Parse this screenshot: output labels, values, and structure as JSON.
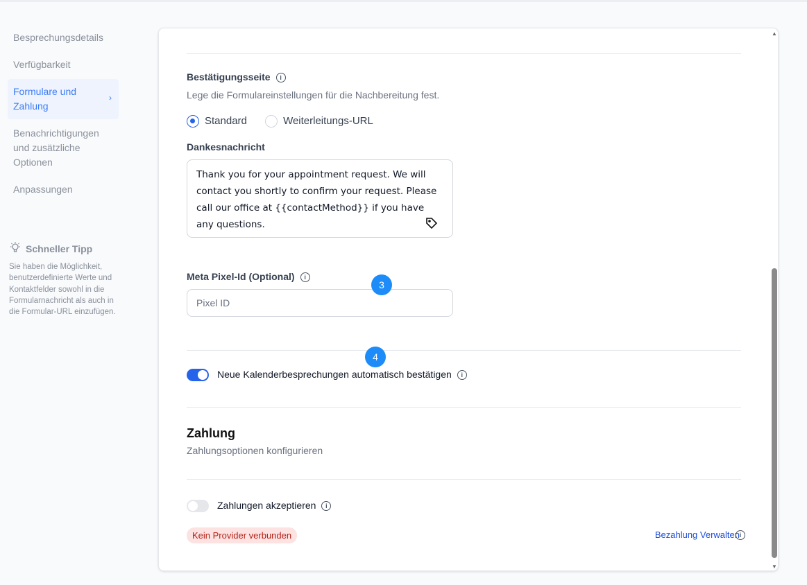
{
  "sidebar": {
    "items": [
      {
        "label": "Besprechungsdetails"
      },
      {
        "label": "Verfügbarkeit"
      },
      {
        "label": "Formulare und Zahlung",
        "active": true
      },
      {
        "label": "Benachrichtigungen und zusätzliche Optionen"
      },
      {
        "label": "Anpassungen"
      }
    ],
    "tip": {
      "title": "Schneller Tipp",
      "text": "Sie haben die Möglichkeit, benutzerdefinierte Werte und Kontaktfelder sowohl in die Formularnachricht als auch in die Formular-URL einzufügen."
    }
  },
  "confirmation": {
    "title": "Bestätigungsseite",
    "description": "Lege die Formulareinstellungen für die Nachbereitung fest.",
    "options": [
      {
        "label": "Standard",
        "selected": true
      },
      {
        "label": "Weiterleitungs-URL",
        "selected": false
      }
    ],
    "thanks_label": "Dankesnachricht",
    "thanks_value": "Thank you for your appointment request. We will contact you shortly to confirm your request. Please call our office at {{contactMethod}} if you have any questions."
  },
  "pixel": {
    "label": "Meta Pixel-Id (Optional)",
    "placeholder": "Pixel ID"
  },
  "badges": [
    "3",
    "4"
  ],
  "auto_confirm": {
    "label": "Neue Kalenderbesprechungen automatisch bestätigen",
    "enabled": true
  },
  "payment": {
    "title": "Zahlung",
    "subtitle": "Zahlungsoptionen konfigurieren",
    "accept_label": "Zahlungen akzeptieren",
    "accept_enabled": false,
    "status": "Kein Provider verbunden",
    "manage_link": "Bezahlung Verwalten"
  },
  "colors": {
    "accent": "#2563eb",
    "badge": "#1d8cf8",
    "status_bg": "#fde2e2",
    "status_text": "#b42318"
  }
}
